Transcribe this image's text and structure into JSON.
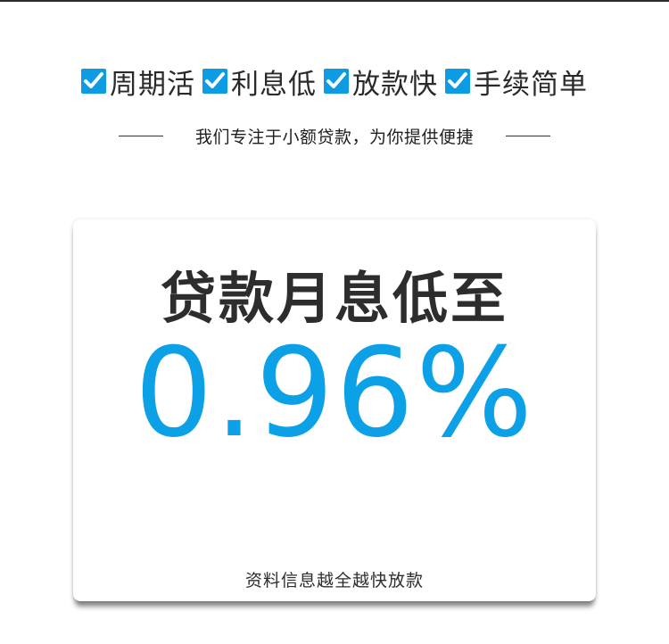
{
  "features": [
    {
      "label": "周期活",
      "icon": "checkbox-checked-icon"
    },
    {
      "label": "利息低",
      "icon": "checkbox-checked-icon"
    },
    {
      "label": "放款快",
      "icon": "checkbox-checked-icon"
    },
    {
      "label": "手续简单",
      "icon": "checkbox-checked-icon"
    }
  ],
  "tagline": "我们专注于小额贷款，为你提供便捷",
  "card": {
    "title": "贷款月息低至",
    "rate": "0.96%",
    "footer": "资料信息越全越快放款"
  },
  "colors": {
    "accent": "#0ca0e6",
    "text": "#2d2d2d"
  }
}
